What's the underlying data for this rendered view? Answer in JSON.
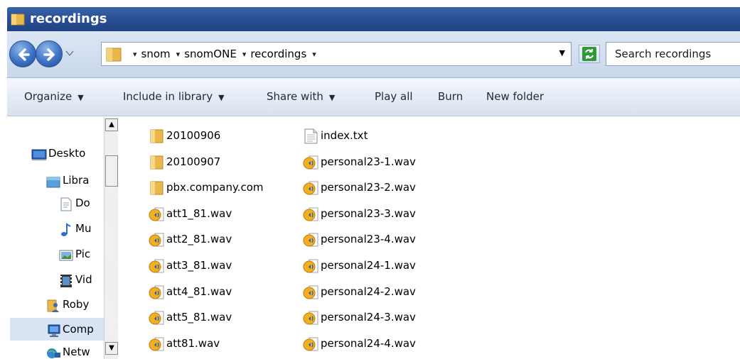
{
  "window": {
    "title": "recordings"
  },
  "address": {
    "crumbs": [
      "snom",
      "snomONE",
      "recordings"
    ]
  },
  "search": {
    "placeholder": "Search recordings"
  },
  "command_bar": {
    "organize": "Organize",
    "include_in_library": "Include in library",
    "share_with": "Share with",
    "play_all": "Play all",
    "burn": "Burn",
    "new_folder": "New folder"
  },
  "nav_pane": {
    "items": [
      {
        "label": "Deskto",
        "icon": "desktop-icon"
      },
      {
        "label": "Libra",
        "icon": "libraries-icon"
      },
      {
        "label": "Do",
        "icon": "documents-icon"
      },
      {
        "label": "Mu",
        "icon": "music-icon"
      },
      {
        "label": "Pic",
        "icon": "pictures-icon"
      },
      {
        "label": "Vid",
        "icon": "videos-icon"
      },
      {
        "label": "Roby",
        "icon": "user-icon"
      },
      {
        "label": "Comp",
        "icon": "computer-icon"
      },
      {
        "label": "Netw",
        "icon": "network-icon"
      }
    ]
  },
  "files": {
    "col1": [
      {
        "name": "20100906",
        "type": "folder"
      },
      {
        "name": "20100907",
        "type": "folder"
      },
      {
        "name": "pbx.company.com",
        "type": "folder"
      },
      {
        "name": "att1_81.wav",
        "type": "wav"
      },
      {
        "name": "att2_81.wav",
        "type": "wav"
      },
      {
        "name": "att3_81.wav",
        "type": "wav"
      },
      {
        "name": "att4_81.wav",
        "type": "wav"
      },
      {
        "name": "att5_81.wav",
        "type": "wav"
      },
      {
        "name": "att81.wav",
        "type": "wav"
      }
    ],
    "col2": [
      {
        "name": "index.txt",
        "type": "txt"
      },
      {
        "name": "personal23-1.wav",
        "type": "wav"
      },
      {
        "name": "personal23-2.wav",
        "type": "wav"
      },
      {
        "name": "personal23-3.wav",
        "type": "wav"
      },
      {
        "name": "personal23-4.wav",
        "type": "wav"
      },
      {
        "name": "personal24-1.wav",
        "type": "wav"
      },
      {
        "name": "personal24-2.wav",
        "type": "wav"
      },
      {
        "name": "personal24-3.wav",
        "type": "wav"
      },
      {
        "name": "personal24-4.wav",
        "type": "wav"
      }
    ]
  }
}
